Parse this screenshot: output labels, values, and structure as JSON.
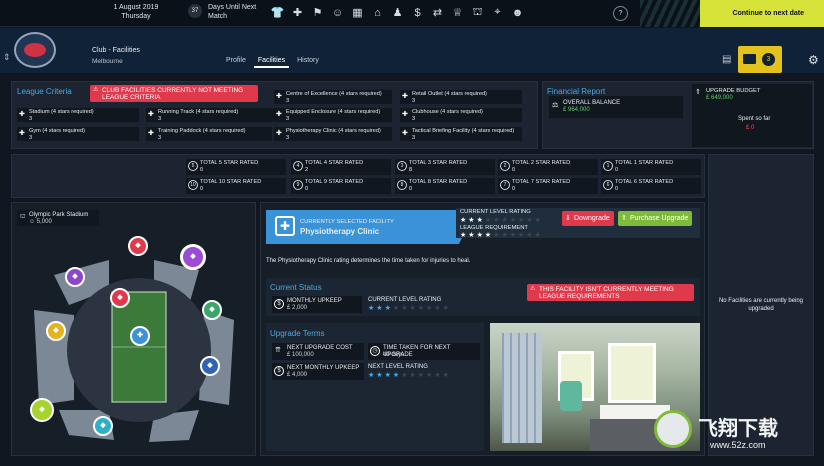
{
  "topbar": {
    "date_line1": "1 August 2019",
    "date_line2": "Thursday",
    "days_count": "37",
    "days_label": "Days Until Next Match",
    "help_icon": "?",
    "continue_label": "Continue to next date",
    "nav_icons": [
      "shirt-icon",
      "first-aid-icon",
      "training-icon",
      "players-icon",
      "tactics-icon",
      "home-icon",
      "staff-icon",
      "finance-icon",
      "transfer-icon",
      "trophy-icon",
      "stadium-icon",
      "scout-icon",
      "fans-icon"
    ]
  },
  "header": {
    "club_title": "Club - Facilities",
    "club_subtitle": "Melbourne",
    "tabs": [
      "Profile",
      "Facilities",
      "History"
    ],
    "active_tab": "Facilities",
    "mail_count": "3"
  },
  "league": {
    "title": "League Criteria",
    "alert": "CLUB FACILITIES CURRENTLY NOT MEETING LEAGUE CRITERIA",
    "criteria": [
      {
        "label": "Stadium (4 stars required)",
        "value": "3"
      },
      {
        "label": "Running Track (4 stars required)",
        "value": "3"
      },
      {
        "label": "Centre of Excellence (4 stars required)",
        "value": "3"
      },
      {
        "label": "Retail Outlet (4 stars required)",
        "value": "3"
      },
      {
        "label": "Gym (4 stars required)",
        "value": "3"
      },
      {
        "label": "Training Paddock (4 stars required)",
        "value": "3"
      },
      {
        "label": "Equipped Enclosure (4 stars required)",
        "value": "3"
      },
      {
        "label": "Clubhouse (4 stars required)",
        "value": "3"
      },
      {
        "label": "Physiotherapy Clinic (4 stars required)",
        "value": "3"
      },
      {
        "label": "Tactical Briefing Facility (4 stars required)",
        "value": "3"
      }
    ]
  },
  "financial": {
    "title": "Financial Report",
    "balance_label": "OVERALL BALANCE",
    "balance_value": "£ 964,000",
    "budget_label": "UPGRADE BUDGET",
    "budget_value": "£ 649,000",
    "spent_label": "Spent so far",
    "spent_value": "£ 0"
  },
  "star_summary": [
    {
      "label": "TOTAL 5 STAR RATED",
      "value": "0",
      "icon": "5"
    },
    {
      "label": "TOTAL 4 STAR RATED",
      "value": "2",
      "icon": "4"
    },
    {
      "label": "TOTAL 3 STAR RATED",
      "value": "8",
      "icon": "3"
    },
    {
      "label": "TOTAL 2 STAR RATED",
      "value": "0",
      "icon": "2"
    },
    {
      "label": "TOTAL 1 STAR RATED",
      "value": "0",
      "icon": "1"
    },
    {
      "label": "TOTAL 10 STAR RATED",
      "value": "0",
      "icon": "10"
    },
    {
      "label": "TOTAL 9 STAR RATED",
      "value": "0",
      "icon": "9"
    },
    {
      "label": "TOTAL 8 STAR RATED",
      "value": "0",
      "icon": "8"
    },
    {
      "label": "TOTAL 7 STAR RATED",
      "value": "0",
      "icon": "7"
    },
    {
      "label": "TOTAL 6 STAR RATED",
      "value": "0",
      "icon": "6"
    }
  ],
  "stadium": {
    "name": "Olympic Park Stadium",
    "capacity": "5,000"
  },
  "selected": {
    "caption": "CURRENTLY SELECTED FACILITY",
    "name": "Physiotherapy Clinic",
    "current_rating_label": "CURRENT LEVEL RATING",
    "current_rating": 3,
    "requirement_label": "LEAGUE REQUIREMENT",
    "requirement": 4,
    "max_stars": 10,
    "downgrade_label": "Downgrade",
    "upgrade_label": "Purchase Upgrade",
    "description": "The Physiotherapy Clinic rating determines the time taken for injuries to heal."
  },
  "status": {
    "title": "Current Status",
    "upkeep_label": "MONTHLY UPKEEP",
    "upkeep_value": "£ 2,000",
    "rating_label": "CURRENT LEVEL RATING",
    "alert": "THIS FACILITY ISN'T CURRENTLY MEETING LEAGUE REQUIREMENTS"
  },
  "upgrade": {
    "title": "Upgrade Terms",
    "cost_label": "NEXT UPGRADE COST",
    "cost_value": "£ 100,000",
    "time_label": "TIME TAKEN FOR NEXT UPGRADE",
    "time_value": "40 days",
    "next_upkeep_label": "NEXT MONTHLY UPKEEP",
    "next_upkeep_value": "£ 4,000",
    "next_rating_label": "NEXT LEVEL RATING",
    "next_rating": 4
  },
  "upgrading": {
    "text": "No Facilities are currently being upgraded"
  },
  "watermark": {
    "text": "飞翔下载",
    "url": "www.52z.com"
  }
}
